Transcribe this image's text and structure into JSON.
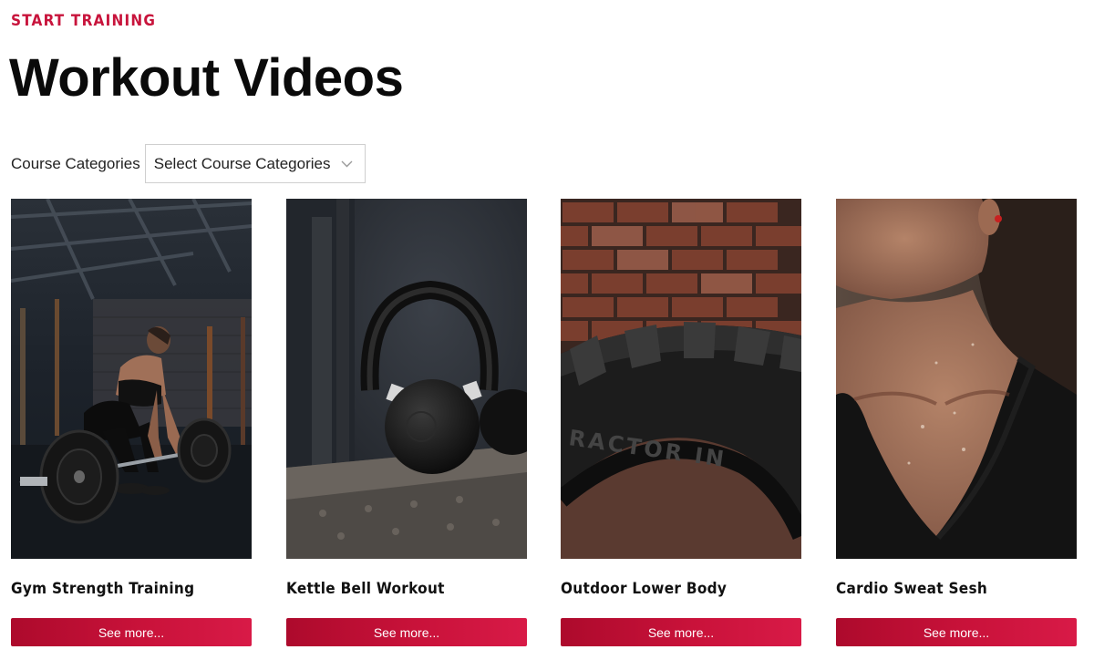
{
  "header": {
    "eyebrow": "START TRAINING",
    "title": "Workout Videos"
  },
  "filter": {
    "label": "Course Categories",
    "selected": "Select Course Categories"
  },
  "cards": [
    {
      "title": "Gym Strength Training",
      "button": "See more..."
    },
    {
      "title": "Kettle Bell Workout",
      "button": "See more..."
    },
    {
      "title": "Outdoor Lower Body",
      "button": "See more..."
    },
    {
      "title": "Cardio Sweat Sesh",
      "button": "See more..."
    }
  ],
  "colors": {
    "accent": "#c8143c",
    "button_start": "#ad0a2c",
    "button_end": "#d81a47"
  },
  "icons": {
    "select_toggle": "chevron-down-icon"
  }
}
